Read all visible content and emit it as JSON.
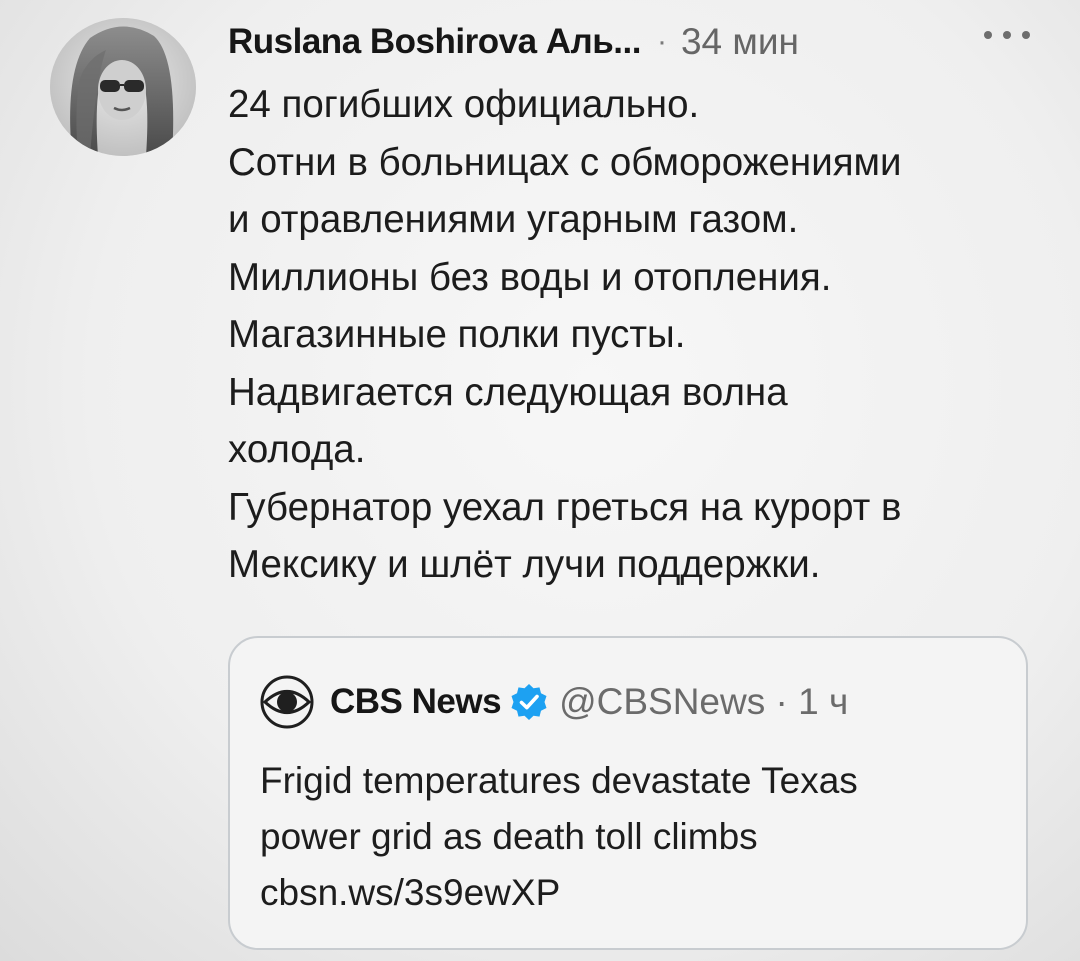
{
  "tweet": {
    "author_name": "Ruslana Boshirova Аль...",
    "separator": "·",
    "time": "34 мин",
    "more_icon": "more-horizontal-icon",
    "lines": [
      "24 погибших официально.",
      "Сотни в больницах с обморожениями",
      "и отравлениями угарным газом.",
      "Миллионы без воды и отопления.",
      "Магазинные полки пусты.",
      "Надвигается следующая волна",
      "холода.",
      "Губернатор уехал греться на курорт в",
      "Мексику и шлёт лучи поддержки."
    ]
  },
  "quoted_tweet": {
    "logo_icon": "cbs-eye-logo",
    "name": "CBS News",
    "verified_icon": "verified-badge-icon",
    "verified_color": "#1da1f2",
    "handle_time": "@CBSNews · 1 ч",
    "lines": [
      "Frigid temperatures devastate Texas",
      "power grid as death toll climbs",
      "cbsn.ws/3s9ewXP"
    ]
  }
}
